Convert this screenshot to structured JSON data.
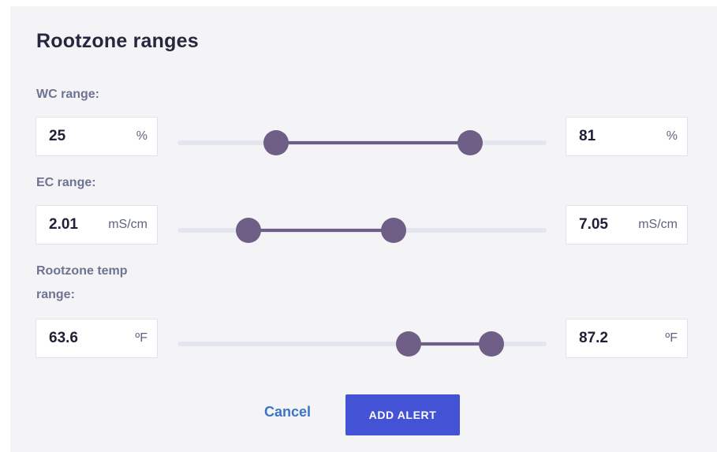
{
  "title": "Rootzone ranges",
  "ranges": [
    {
      "label": "WC range:",
      "min_value": "25",
      "max_value": "81",
      "unit": "%",
      "fill_start": 0.268,
      "fill_end": 0.793
    },
    {
      "label": "EC range:",
      "min_value": "2.01",
      "max_value": "7.05",
      "unit": "mS/cm",
      "fill_start": 0.192,
      "fill_end": 0.585
    },
    {
      "label": "Rootzone temp range:",
      "min_value": "63.6",
      "max_value": "87.2",
      "unit": "ºF",
      "fill_start": 0.626,
      "fill_end": 0.85
    }
  ],
  "actions": {
    "cancel_label": "Cancel",
    "add_label": "ADD ALERT"
  },
  "colors": {
    "accent": "#6f5e86",
    "primary_button": "#4452d6",
    "link": "#3a74c9"
  }
}
